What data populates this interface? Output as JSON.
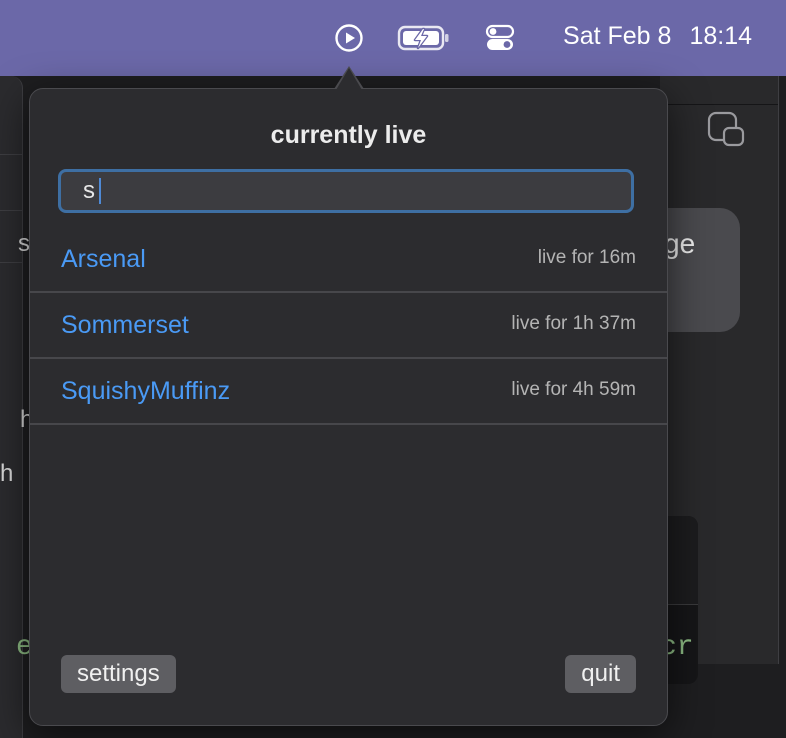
{
  "menubar": {
    "date": "Sat Feb 8",
    "time": "18:14",
    "icons": [
      "play-circle-icon",
      "battery-charging-icon",
      "control-center-icon"
    ],
    "background_color": "#6b68a8"
  },
  "background_app": {
    "bubble_text": "ge",
    "code_text": "cr",
    "left_code_text": "e",
    "left_chars": [
      "h",
      "h",
      "s"
    ]
  },
  "popover": {
    "title": "currently live",
    "search": {
      "value": "s",
      "placeholder": ""
    },
    "streams": [
      {
        "name": "Arsenal",
        "duration": "live for 16m"
      },
      {
        "name": "Sommerset",
        "duration": "live for 1h 37m"
      },
      {
        "name": "SquishyMuffinz",
        "duration": "live for 4h 59m"
      }
    ],
    "settings_label": "settings",
    "quit_label": "quit",
    "link_color": "#4a9af5"
  }
}
